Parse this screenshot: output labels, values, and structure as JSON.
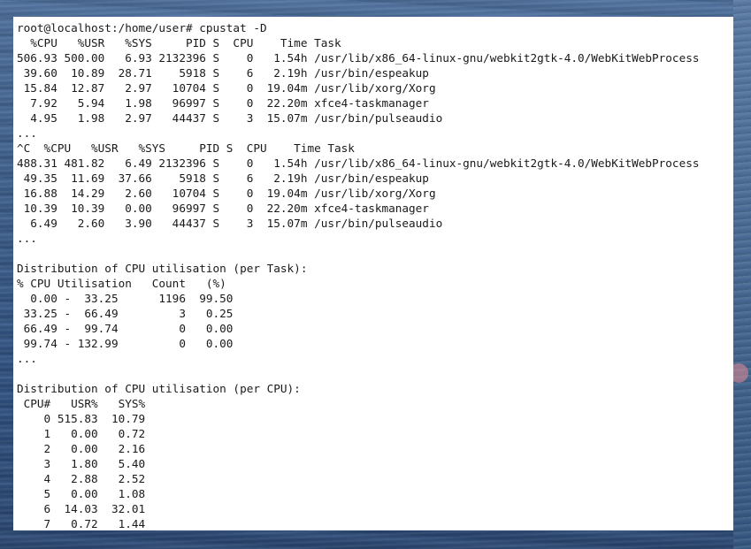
{
  "terminal": {
    "lines": [
      "root@localhost:/home/user# cpustat -D",
      "  %CPU   %USR   %SYS     PID S  CPU    Time Task",
      "506.93 500.00   6.93 2132396 S    0   1.54h /usr/lib/x86_64-linux-gnu/webkit2gtk-4.0/WebKitWebProcess",
      " 39.60  10.89  28.71    5918 S    6   2.19h /usr/bin/espeakup",
      " 15.84  12.87   2.97   10704 S    0  19.04m /usr/lib/xorg/Xorg",
      "  7.92   5.94   1.98   96997 S    0  22.20m xfce4-taskmanager",
      "  4.95   1.98   2.97   44437 S    3  15.07m /usr/bin/pulseaudio",
      "...",
      "^C  %CPU   %USR   %SYS     PID S  CPU    Time Task",
      "488.31 481.82   6.49 2132396 S    0   1.54h /usr/lib/x86_64-linux-gnu/webkit2gtk-4.0/WebKitWebProcess",
      " 49.35  11.69  37.66    5918 S    6   2.19h /usr/bin/espeakup",
      " 16.88  14.29   2.60   10704 S    0  19.04m /usr/lib/xorg/Xorg",
      " 10.39  10.39   0.00   96997 S    0  22.20m xfce4-taskmanager",
      "  6.49   2.60   3.90   44437 S    3  15.07m /usr/bin/pulseaudio",
      "...",
      "",
      "Distribution of CPU utilisation (per Task):",
      "% CPU Utilisation   Count   (%)",
      "  0.00 -  33.25      1196  99.50",
      " 33.25 -  66.49         3   0.25",
      " 66.49 -  99.74         0   0.00",
      " 99.74 - 132.99         0   0.00",
      "...",
      "",
      "Distribution of CPU utilisation (per CPU):",
      " CPU#   USR%   SYS%",
      "    0 515.83  10.79",
      "    1   0.00   0.72",
      "    2   0.00   2.16",
      "    3   1.80   5.40",
      "    4   2.88   2.52",
      "    5   0.00   1.08",
      "    6  14.03  32.01",
      "    7   0.72   1.44"
    ]
  }
}
